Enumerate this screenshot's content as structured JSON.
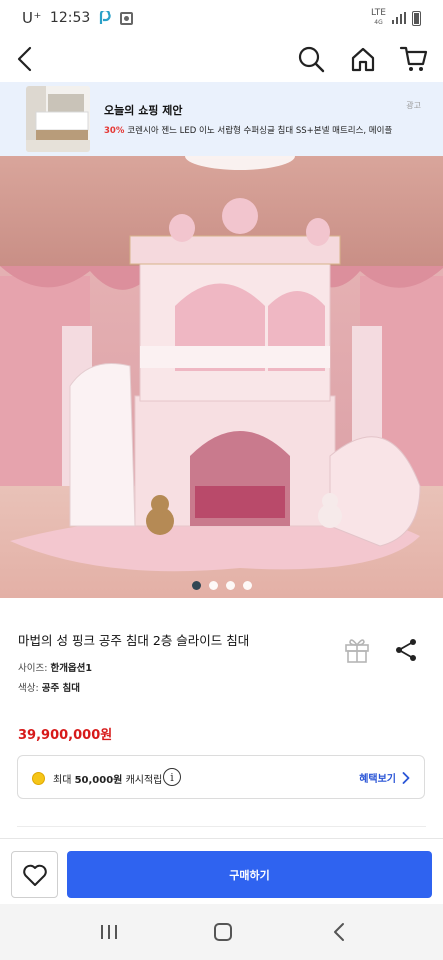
{
  "status_bar": {
    "carrier": "U⁺",
    "time": "12:53",
    "network": "LTE",
    "network_sub": "4G"
  },
  "nav": {
    "back_icon": "chevron-left-icon",
    "search_icon": "search-icon",
    "home_icon": "home-icon",
    "cart_icon": "cart-icon"
  },
  "suggestion": {
    "title": "오늘의 쇼핑 제안",
    "discount": "30%",
    "description": "코렌시아 젠느 LED 이노 서랍형 수퍼싱글 침대 SS+본넬 매트리스, 메이플",
    "ad_label": "광고"
  },
  "gallery": {
    "page_count": 4,
    "active_index": 0
  },
  "product": {
    "title": "마법의 성 핑크 공주 침대 2층 슬라이드 침대",
    "size_label": "사이즈:",
    "size_value": "한개옵션1",
    "color_label": "색상:",
    "color_value": "공주 침대",
    "price": "39,900,000원"
  },
  "cashback": {
    "prefix": "최대",
    "amount": "50,000원",
    "suffix": "캐시적립",
    "info_symbol": "i",
    "benefit_link": "혜택보기"
  },
  "purchase": {
    "buy_label": "구매하기"
  },
  "colors": {
    "accent_blue": "#2f63f0",
    "price_red": "#d71a1a",
    "banner_bg": "#eaf1fc",
    "link_blue": "#2a55d6"
  }
}
